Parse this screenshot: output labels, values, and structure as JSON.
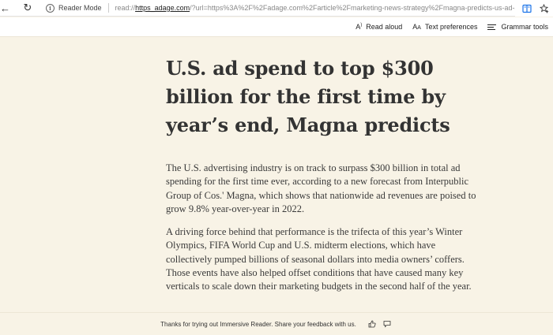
{
  "browser": {
    "reader_mode_label": "Reader Mode",
    "url_prefix": "read://",
    "url_host": "https_adage.com",
    "url_rest": "/?url=https%3A%2F%2Fadage.com%2Farticle%2Fmarketing-news-strategy%2Fmagna-predicts-us-ad-sp..."
  },
  "toolbar": {
    "read_aloud": "Read aloud",
    "text_preferences": "Text preferences",
    "grammar_tools": "Grammar tools"
  },
  "article": {
    "headline": "U.S. ad spend to top $300 billion for the first time by year’s end, Magna predicts",
    "paragraphs": [
      "The U.S. advertising industry is on track to surpass $300 billion in total ad spending for the first time ever, according to a new forecast from Interpublic Group of Cos.' Magna, which shows that nationwide ad revenues are poised to grow 9.8% year-over-year in 2022.",
      "A driving force behind that performance is the trifecta of this year’s Winter Olympics, FIFA World Cup and U.S. midterm elections, which have collectively pumped billions of seasonal dollars into media owners’ coffers. Those events have also helped offset conditions that have caused many key verticals to scale down their marketing budgets in the second half of the year."
    ]
  },
  "footer": {
    "feedback_text": "Thanks for trying out Immersive Reader. Share your feedback with us."
  },
  "colors": {
    "page_background": "#f8f3e6",
    "text": "#333333",
    "accent_icon": "#1a73e8"
  },
  "icons": {
    "back": "arrow-left-icon",
    "refresh": "refresh-icon",
    "info": "info-icon",
    "immersive_reader": "immersive-reader-icon",
    "favorite": "star-add-icon",
    "read_aloud": "read-aloud-icon",
    "text_preferences": "text-preferences-icon",
    "grammar_tools": "grammar-tools-icon",
    "thumbs_up": "thumbs-up-icon",
    "feedback": "feedback-comment-icon"
  }
}
